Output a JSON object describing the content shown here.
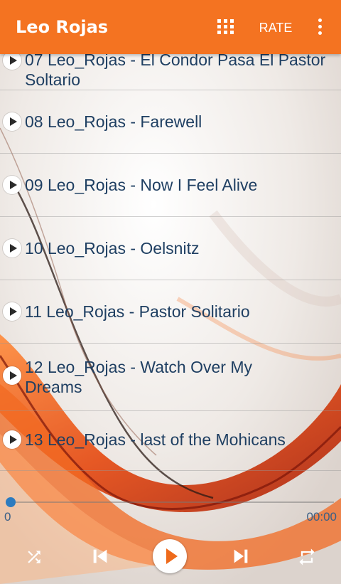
{
  "appbar": {
    "title": "Leo Rojas",
    "rate_label": "RATE",
    "icons": [
      "grid-icon",
      "more-vert-icon"
    ]
  },
  "songs": [
    {
      "title": "07 Leo_Rojas - El Condor Pasa El Pastor Soltario"
    },
    {
      "title": "08 Leo_Rojas - Farewell"
    },
    {
      "title": "09 Leo_Rojas - Now I Feel Alive"
    },
    {
      "title": "10 Leo_Rojas - Oelsnitz"
    },
    {
      "title": "11 Leo_Rojas - Pastor Solitario"
    },
    {
      "title": "12 Leo_Rojas - Watch Over My Dreams"
    },
    {
      "title": "13 Leo_Rojas - last of the Mohicans"
    }
  ],
  "player": {
    "elapsed": "0",
    "duration": "00:00",
    "progress_fraction": 0.0,
    "icons": [
      "shuffle-icon",
      "skip-previous-icon",
      "play-icon",
      "skip-next-icon",
      "repeat-icon"
    ]
  },
  "colors": {
    "appbar": "#f47321",
    "song_text": "#1f3f62",
    "progress": "#1f6fb5",
    "play_accent": "#ee6a1b"
  }
}
